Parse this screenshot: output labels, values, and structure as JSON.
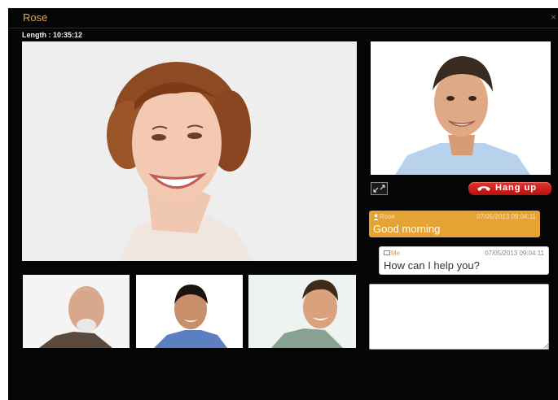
{
  "window": {
    "title": "Rose",
    "close_glyph": "×"
  },
  "call": {
    "length_label": "Length : 10:35:12"
  },
  "controls": {
    "hangup_label": "Hang up",
    "expand_icon": "expand-icon",
    "phone_icon": "phone-hangup-icon"
  },
  "chat": {
    "messages": [
      {
        "author": "Rose",
        "time": "07/05/2013 09:04:11",
        "text": "Good morning",
        "icon": "person-icon"
      },
      {
        "author": "Me",
        "time": "07/05/2013 09:04:11",
        "text": "How can I help you?",
        "icon": "chat-bubble-icon"
      }
    ],
    "input_value": ""
  },
  "colors": {
    "accent": "#e5a334",
    "hangup": "#d4201d",
    "background": "#050505"
  }
}
